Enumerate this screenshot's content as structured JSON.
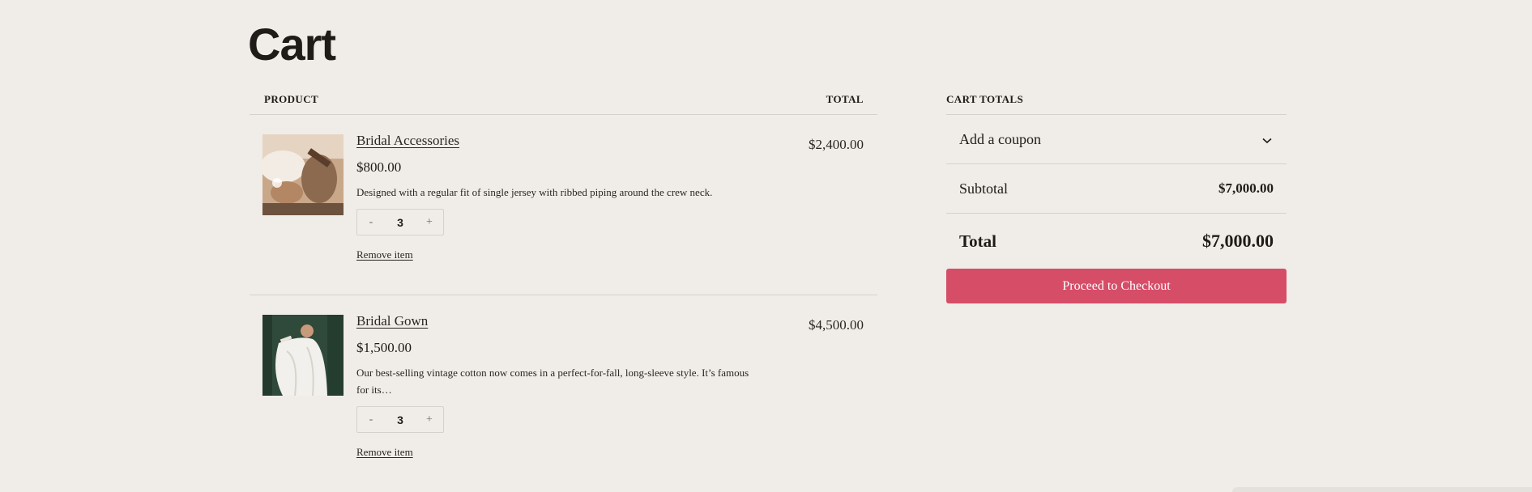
{
  "page": {
    "title": "Cart"
  },
  "cart_table": {
    "header_product": "PRODUCT",
    "header_total": "TOTAL",
    "items": [
      {
        "name": "Bridal Accessories",
        "unit_price": "$800.00",
        "description": "Designed with a regular fit of single jersey with ribbed piping around the crew neck.",
        "quantity": "3",
        "decrement": "-",
        "increment": "+",
        "remove_label": "Remove item",
        "line_total": "$2,400.00",
        "image_icon": "product-photo-accessories"
      },
      {
        "name": "Bridal Gown",
        "unit_price": "$1,500.00",
        "description": "Our best-selling vintage cotton now comes in a perfect-for-fall, long-sleeve style. It’s famous for its…",
        "quantity": "3",
        "decrement": "-",
        "increment": "+",
        "remove_label": "Remove item",
        "line_total": "$4,500.00",
        "image_icon": "product-photo-gown"
      }
    ]
  },
  "cart_totals": {
    "heading": "CART TOTALS",
    "coupon_label": "Add a coupon",
    "coupon_icon": "chevron-down-icon",
    "subtotal_label": "Subtotal",
    "subtotal_value": "$7,000.00",
    "total_label": "Total",
    "total_value": "$7,000.00",
    "checkout_label": "Proceed to Checkout"
  },
  "colors": {
    "background": "#f0ece7",
    "accent": "#d64d68",
    "text": "#1e1b18",
    "divider": "#d6d1cb"
  }
}
